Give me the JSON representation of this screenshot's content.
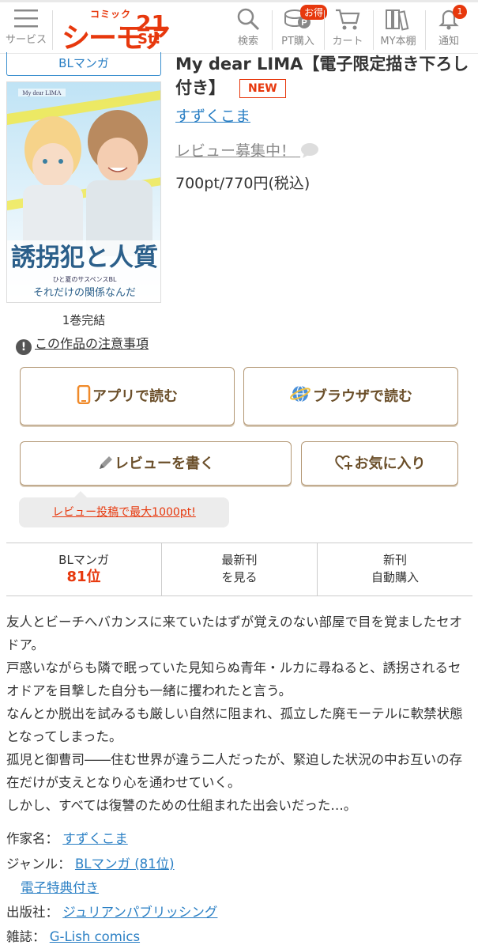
{
  "header": {
    "menu_label": "サービス",
    "logo_small": "コミック",
    "logo_big": "シーモア",
    "logo_num": "21",
    "logo_st": "St!",
    "search_label": "検索",
    "pt_label": "PT購入",
    "otoku_badge": "お得",
    "cart_label": "カート",
    "shelf_label": "MY本棚",
    "notify_label": "通知",
    "notify_count": "1"
  },
  "product": {
    "genre_tab": "BLマンガ",
    "title": "My dear LIMA【電子限定描き下ろし付き】",
    "new_badge": "NEW",
    "author": "すずくこま",
    "review_status": "レビュー募集中！",
    "price": "700pt/770円(税込)",
    "volume": "1巻完結",
    "notice_icon": "!",
    "notice": "この作品の注意事項"
  },
  "cover": {
    "header_text": "My dear LIMA",
    "title_jp": "誘拐犯と人質",
    "subtitle": "ひと夏のサスペンスBL",
    "tagline": "それだけの関係なんだ"
  },
  "actions": {
    "read_app": "アプリで読む",
    "read_browser": "ブラウザで読む",
    "write_review": "レビューを書く",
    "favorite": "お気に入り",
    "review_tip": "レビュー投稿で最大1000pt!"
  },
  "stats": {
    "genre_label": "BLマンガ",
    "genre_rank": "81位",
    "latest_line1": "最新刊",
    "latest_line2": "を見る",
    "auto_line1": "新刊",
    "auto_line2": "自動購入"
  },
  "description": [
    "友人とビーチへバカンスに来ていたはずが覚えのない部屋で目を覚ましたセオドア。",
    "戸惑いながらも隣で眠っていた見知らぬ青年・ルカに尋ねると、誘拐されるセオドアを目撃した自分も一緒に攫われたと言う。",
    "なんとか脱出を試みるも厳しい自然に阻まれ、孤立した廃モーテルに軟禁状態となってしまった。",
    "孤児と御曹司――住む世界が違う二人だったが、緊迫した状況の中お互いの存在だけが支えとなり心を通わせていく。",
    "しかし、すべては復讐のための仕組まれた出会いだった…。"
  ],
  "meta": {
    "author_label": "作家名：",
    "author_value": "すずくこま",
    "genre_label": "ジャンル：",
    "genre_value": "BLマンガ (81位)",
    "genre_extra": "電子特典付き",
    "publisher_label": "出版社：",
    "publisher_value": "ジュリアンパブリッシング",
    "magazine_label": "雑誌：",
    "magazine_value": "G-Lish comics"
  },
  "colors": {
    "accent": "#e7380d",
    "link": "#2a7fc4",
    "button_text": "#6b4f2a"
  }
}
